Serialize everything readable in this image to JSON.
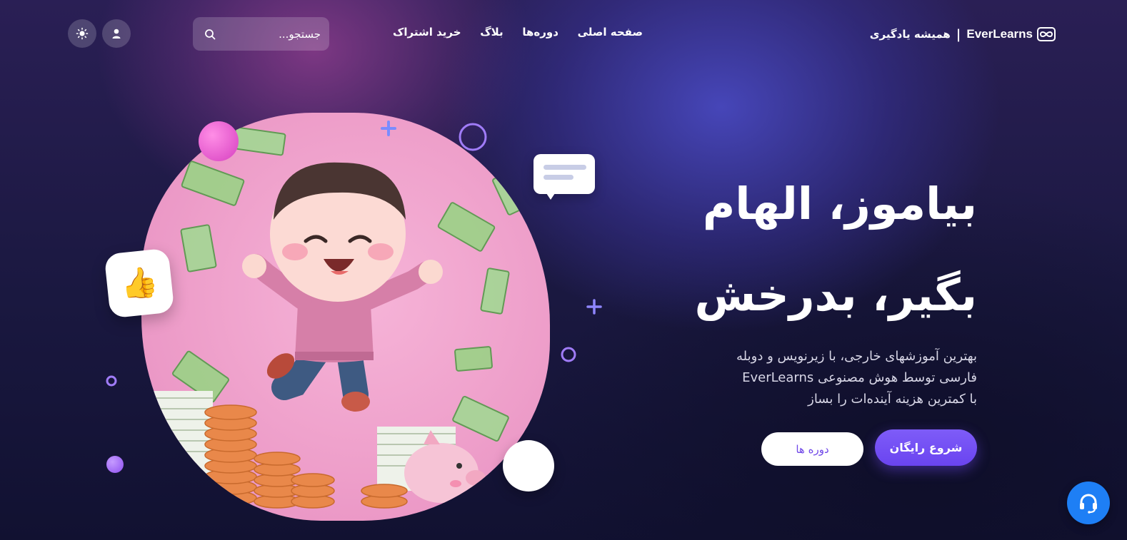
{
  "header": {
    "brand_name": "EverLearns",
    "brand_separator": "|",
    "brand_tagline": "همیشه یادگیری",
    "nav": [
      "صفحه اصلی",
      "دوره‌ها",
      "بلاگ",
      "خرید اشتراک"
    ],
    "search_placeholder": "جستجو...",
    "user_icon": "user-icon",
    "theme_icon": "sun-icon"
  },
  "hero": {
    "title_line1": "بیاموز، الهام",
    "title_line2": "بگیر، بدرخش",
    "description_line1": "بهترین آموزشهای خارجی، با زیرنویس و دوبله",
    "description_line2": "فارسی توسط هوش مصنوعی EverLearns",
    "description_line3": "با کمترین هزینه آینده‌ات را بساز",
    "primary_button": "شروع رایگان",
    "secondary_button": "دوره ها"
  },
  "illustration": {
    "thumbs_emoji": "👍",
    "surprised_emoji": "😲",
    "chat_icon": "chat-bubble-icon"
  },
  "colors": {
    "accent": "#6a44f0",
    "support": "#1e7ff5",
    "blob_pink": "#ee9fca"
  },
  "support_icon": "headset-icon"
}
